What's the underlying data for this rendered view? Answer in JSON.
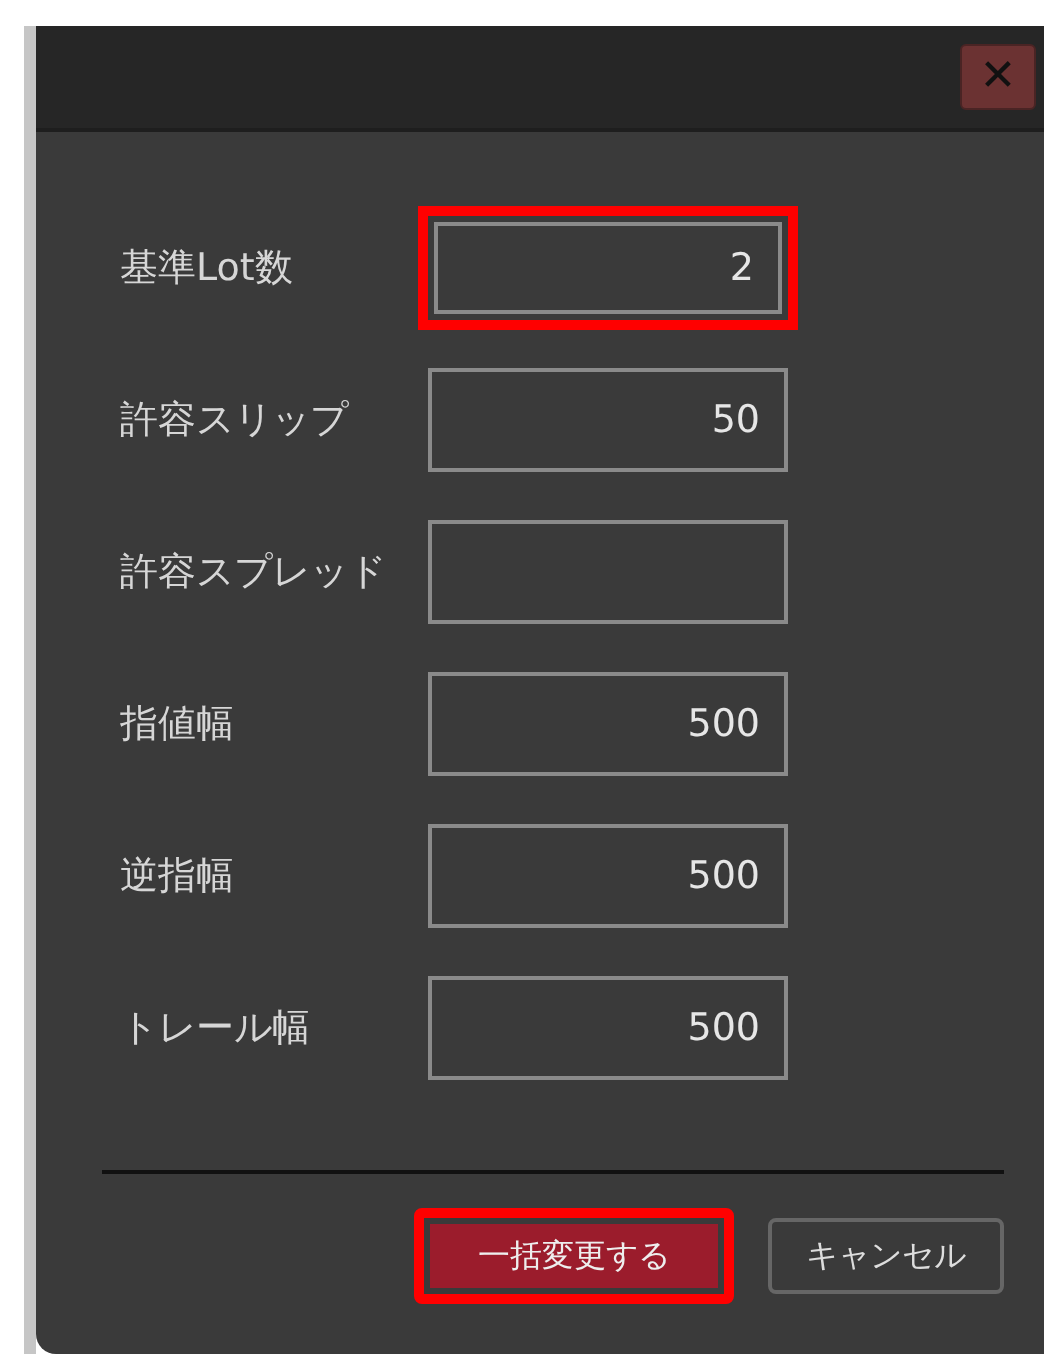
{
  "window": {
    "close_label": "✕"
  },
  "fields": [
    {
      "label": "基準Lot数",
      "value": "2",
      "highlighted": true
    },
    {
      "label": "許容スリップ",
      "value": "50",
      "highlighted": false
    },
    {
      "label": "許容スプレッド",
      "highlighted": false
    },
    {
      "label": "指値幅",
      "value": "500",
      "highlighted": false
    },
    {
      "label": "逆指幅",
      "value": "500",
      "highlighted": false
    },
    {
      "label": "トレール幅",
      "value": "500",
      "highlighted": false
    }
  ],
  "buttons": [
    {
      "label": "一括変更する",
      "kind": "primary",
      "highlighted": true
    },
    {
      "label": "キャンセル",
      "kind": "secondary",
      "highlighted": false
    }
  ]
}
